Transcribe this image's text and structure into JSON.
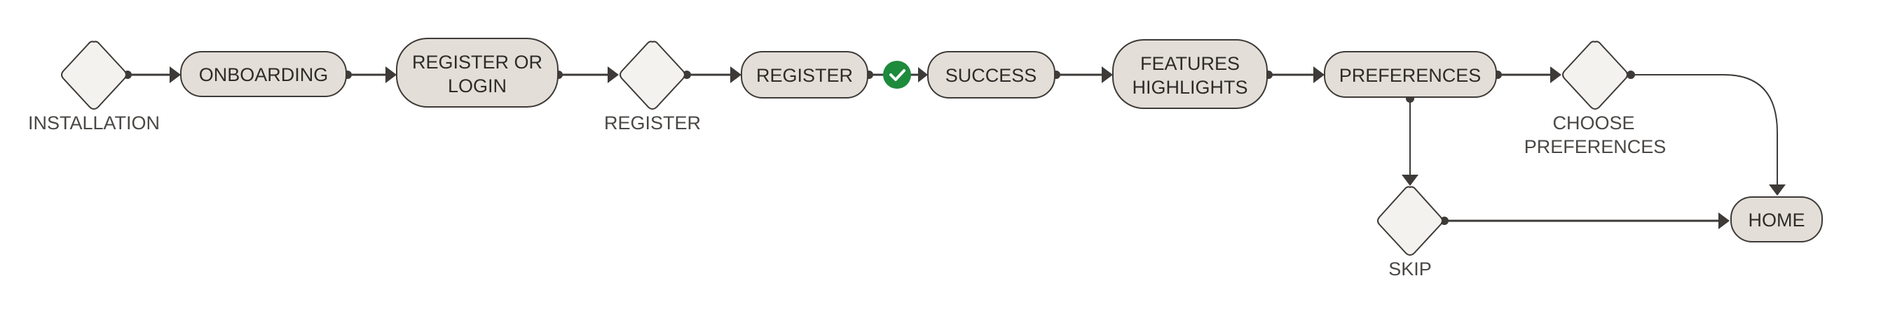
{
  "diagram": {
    "nodes": {
      "installation": "INSTALLATION",
      "onboarding": "ONBOARDING",
      "register_or_login_1": "REGISTER OR",
      "register_or_login_2": "LOGIN",
      "register_decision": "REGISTER",
      "register": "REGISTER",
      "success": "SUCCESS",
      "features_1": "FEATURES",
      "features_2": "HIGHLIGHTS",
      "preferences": "PREFERENCES",
      "choose_1": "CHOOSE",
      "choose_2": "PREFERENCES",
      "skip": "SKIP",
      "home": "HOME"
    },
    "colors": {
      "node_fill": "#e3ded7",
      "decision_fill": "#f4f2ef",
      "stroke": "#3d3a37",
      "success_check": "#1e8a3c"
    }
  }
}
